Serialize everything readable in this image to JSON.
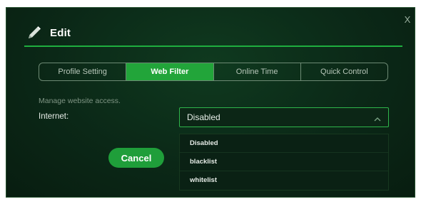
{
  "dialog": {
    "title": "Edit",
    "close_label": "X"
  },
  "tabs": [
    {
      "label": "Profile Setting",
      "active": false
    },
    {
      "label": "Web Filter",
      "active": true
    },
    {
      "label": "Online Time",
      "active": false
    },
    {
      "label": "Quick Control",
      "active": false
    }
  ],
  "form": {
    "hint": "Manage website access.",
    "internet_label": "Internet:",
    "internet_value": "Disabled",
    "options": [
      "Disabled",
      "blacklist",
      "whitelist"
    ]
  },
  "buttons": {
    "cancel_label": "Cancel"
  },
  "colors": {
    "accent": "#22a53a",
    "background": "#0b2817"
  },
  "icons": {
    "title": "pencil-icon",
    "close": "close-icon",
    "select": "chevron-up-icon"
  }
}
